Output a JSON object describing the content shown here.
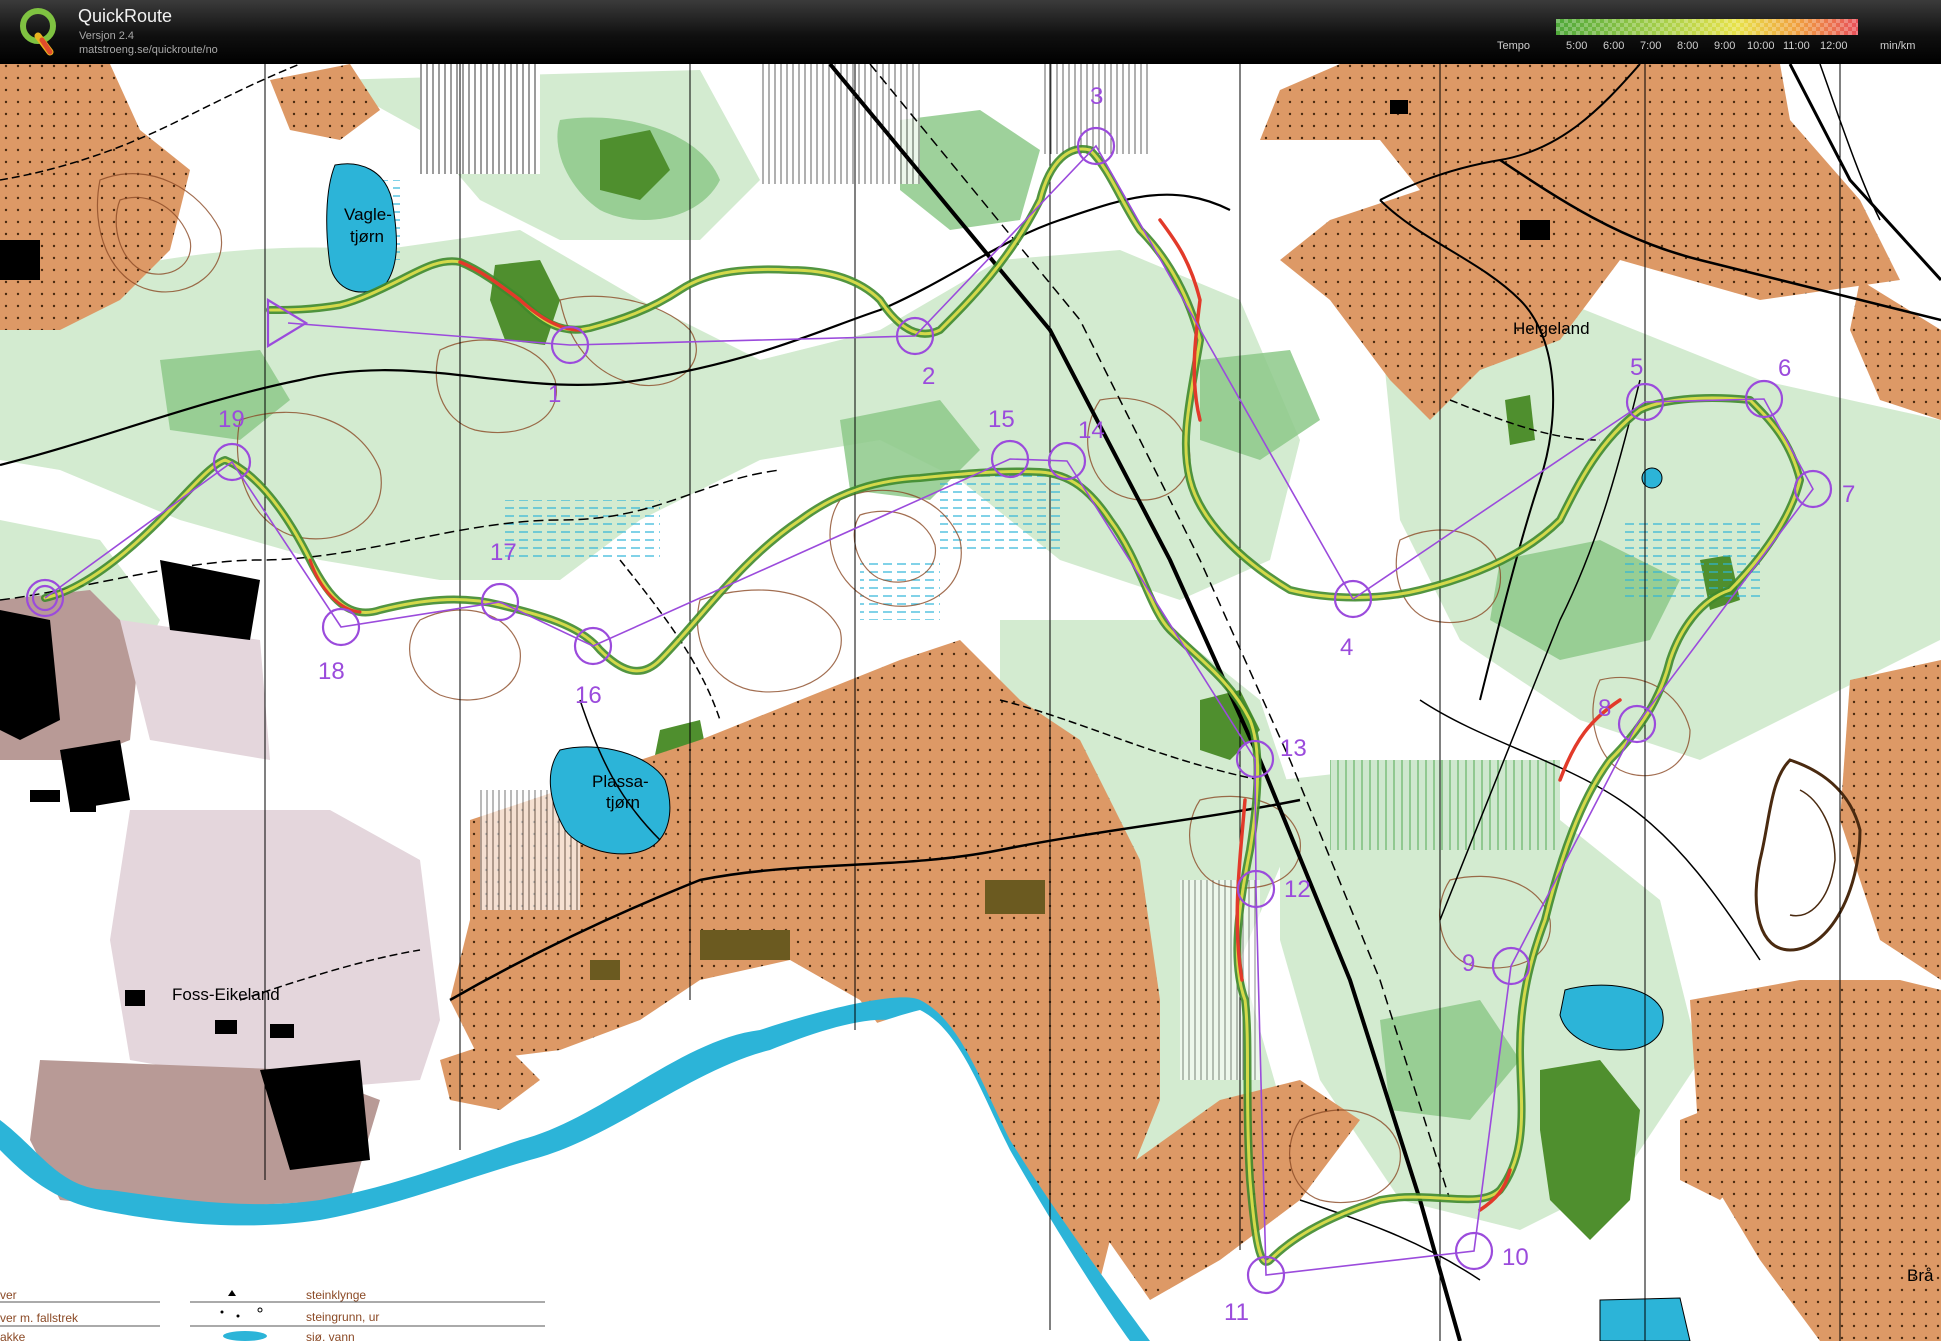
{
  "app": {
    "title": "QuickRoute",
    "version": "Versjon 2.4",
    "url": "matstroeng.se/quickroute/no"
  },
  "tempo": {
    "label": "Tempo",
    "ticks": [
      "5:00",
      "6:00",
      "7:00",
      "8:00",
      "9:00",
      "10:00",
      "11:00",
      "12:00"
    ],
    "unit": "min/km"
  },
  "map": {
    "places": [
      "Vagle-",
      "tjørn",
      "Helgeland",
      "Plassa-",
      "tjørn",
      "Foss-Eikeland",
      "Brå"
    ],
    "controls": [
      "1",
      "2",
      "3",
      "4",
      "5",
      "6",
      "7",
      "8",
      "9",
      "10",
      "11",
      "12",
      "13",
      "14",
      "15",
      "16",
      "17",
      "18",
      "19"
    ],
    "legend": [
      "ver",
      "ver m. fallstrek",
      "akke",
      "steinklynge",
      "steingrunn, ur",
      "sjø, vann"
    ]
  },
  "colors": {
    "forest": "#ffffff",
    "green_light": "#cfe8cf",
    "green_mid": "#7cbf7c",
    "green_dark": "#4a8a2a",
    "open_land": "#dd9966",
    "water": "#2cb4d8",
    "course": "#9b4bdc",
    "route_slow": "#e23a2a",
    "route_fast": "#3f8a2c",
    "contour": "#8b4a26"
  }
}
